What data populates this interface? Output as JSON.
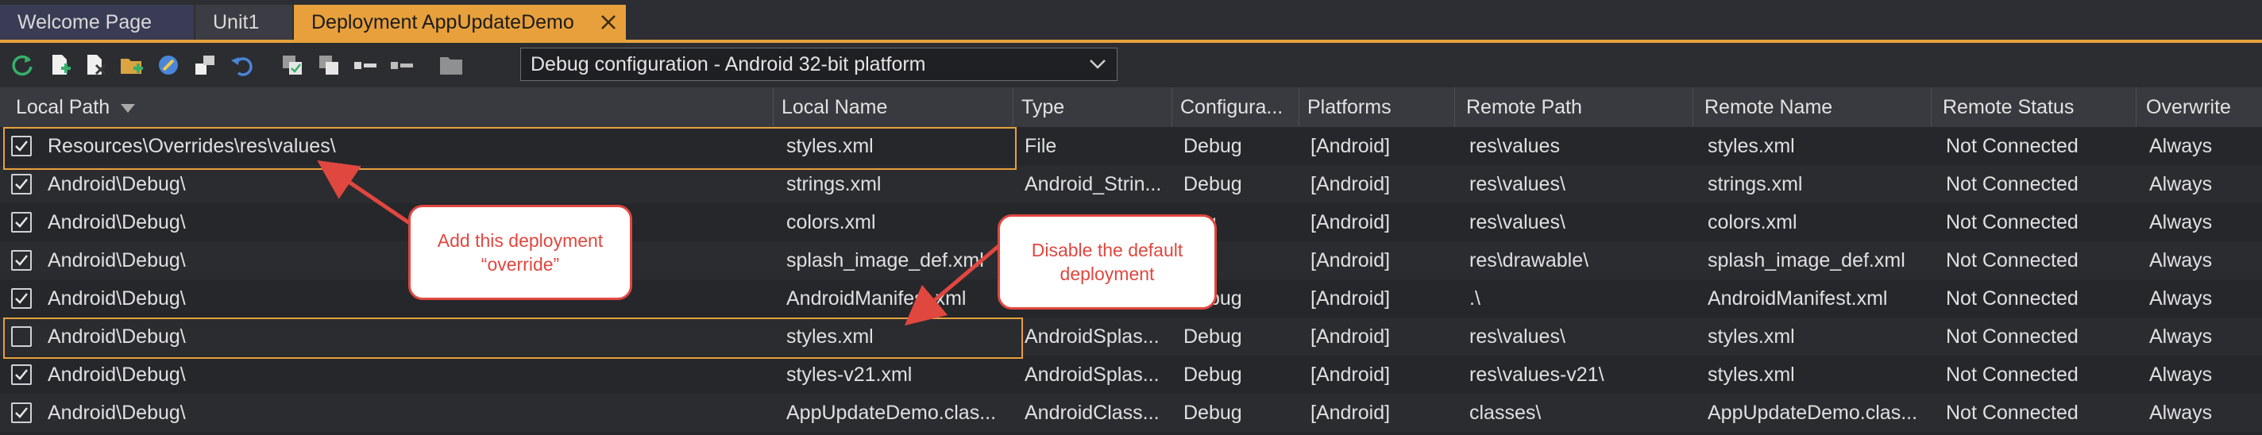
{
  "tabs": [
    {
      "label": "Welcome Page"
    },
    {
      "label": "Unit1"
    },
    {
      "label": "Deployment AppUpdateDemo"
    }
  ],
  "toolbar": {
    "config_value": "Debug configuration - Android 32-bit platform"
  },
  "columns": [
    "Local Path",
    "Local Name",
    "Type",
    "Configura...",
    "Platforms",
    "Remote Path",
    "Remote Name",
    "Remote Status",
    "Overwrite"
  ],
  "rows": [
    {
      "checked": true,
      "local_path": "Resources\\Overrides\\res\\values\\",
      "local_name": "styles.xml",
      "type": "File",
      "config": "Debug",
      "platforms": "[Android]",
      "remote_path": "res\\values",
      "remote_name": "styles.xml",
      "status": "Not Connected",
      "overwrite": "Always"
    },
    {
      "checked": true,
      "local_path": "Android\\Debug\\",
      "local_name": "strings.xml",
      "type": "Android_Strin...",
      "config": "Debug",
      "platforms": "[Android]",
      "remote_path": "res\\values\\",
      "remote_name": "strings.xml",
      "status": "Not Connected",
      "overwrite": "Always"
    },
    {
      "checked": true,
      "local_path": "Android\\Debug\\",
      "local_name": "colors.xml",
      "type": "",
      "config": "bug",
      "platforms": "[Android]",
      "remote_path": "res\\values\\",
      "remote_name": "colors.xml",
      "status": "Not Connected",
      "overwrite": "Always"
    },
    {
      "checked": true,
      "local_path": "Android\\Debug\\",
      "local_name": "splash_image_def.xml",
      "type": "",
      "config": "bug",
      "platforms": "[Android]",
      "remote_path": "res\\drawable\\",
      "remote_name": "splash_image_def.xml",
      "status": "Not Connected",
      "overwrite": "Always"
    },
    {
      "checked": true,
      "local_path": "Android\\Debug\\",
      "local_name": "AndroidManifest.xml",
      "type": "ProjectAndro...",
      "config": "Debug",
      "platforms": "[Android]",
      "remote_path": ".\\",
      "remote_name": "AndroidManifest.xml",
      "status": "Not Connected",
      "overwrite": "Always"
    },
    {
      "checked": false,
      "local_path": "Android\\Debug\\",
      "local_name": "styles.xml",
      "type": "AndroidSplas...",
      "config": "Debug",
      "platforms": "[Android]",
      "remote_path": "res\\values\\",
      "remote_name": "styles.xml",
      "status": "Not Connected",
      "overwrite": "Always"
    },
    {
      "checked": true,
      "local_path": "Android\\Debug\\",
      "local_name": "styles-v21.xml",
      "type": "AndroidSplas...",
      "config": "Debug",
      "platforms": "[Android]",
      "remote_path": "res\\values-v21\\",
      "remote_name": "styles.xml",
      "status": "Not Connected",
      "overwrite": "Always"
    },
    {
      "checked": true,
      "local_path": "Android\\Debug\\",
      "local_name": "AppUpdateDemo.clas...",
      "type": "AndroidClass...",
      "config": "Debug",
      "platforms": "[Android]",
      "remote_path": "classes\\",
      "remote_name": "AppUpdateDemo.clas...",
      "status": "Not Connected",
      "overwrite": "Always"
    }
  ],
  "callouts": {
    "add_override": {
      "line1": "Add this deployment",
      "line2": "“override”"
    },
    "disable_default": {
      "line1": "Disable the default",
      "line2": "deployment"
    }
  },
  "colors": {
    "accent": "#e7a03b",
    "callout": "#e0473f"
  },
  "icons": [
    "refresh-icon",
    "add-files-icon",
    "remove-files-icon",
    "add-folder-icon",
    "connect-icon",
    "add-featured-icon",
    "revert-icon",
    "copy-config-icon",
    "deploy-icon",
    "select-all-icon",
    "deselect-all-icon",
    "folder-icon"
  ]
}
